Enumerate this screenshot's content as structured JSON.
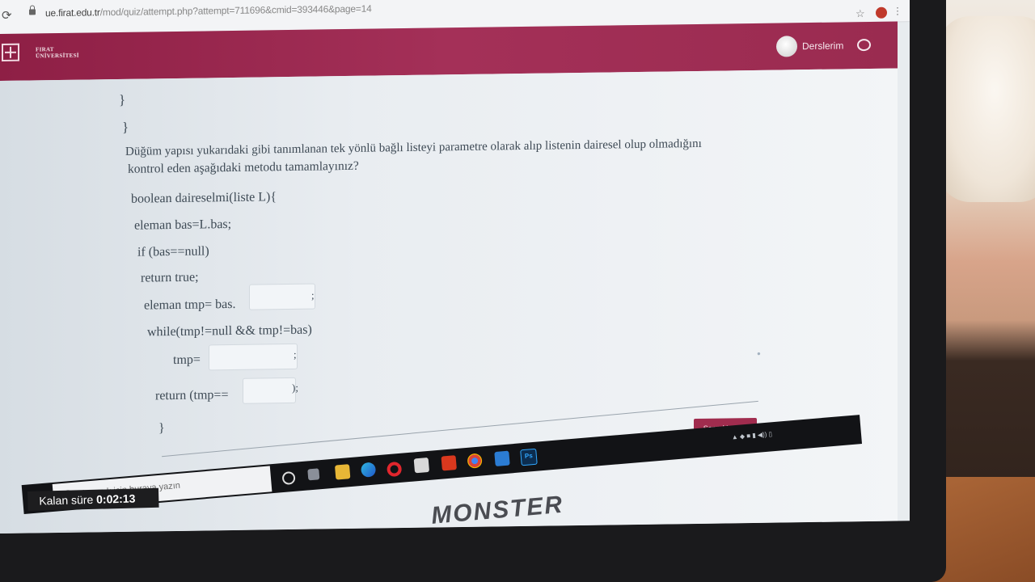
{
  "browser": {
    "url_host": "ue.firat.edu.tr",
    "url_path": "/mod/quiz/attempt.php?attempt=711696&cmid=393446&page=14",
    "icons": [
      "reload-icon",
      "lock-icon",
      "star-icon",
      "profile-icon",
      "menu-icon"
    ]
  },
  "site": {
    "logo_line1": "FIRAT",
    "logo_line2": "ÜNİVERSİTESİ",
    "nav_courses": "Derslerim",
    "brand_color": "#9a2b50"
  },
  "question": {
    "brace_inner": "}",
    "brace_outer": "}",
    "prompt_line1": "Düğüm yapısı yukarıdaki gibi tanımlanan tek yönlü bağlı listeyi parametre olarak alıp listenin dairesel olup olmadığını",
    "prompt_line2": "kontrol eden aşağıdaki metodu tamamlayınız?",
    "code": {
      "line1": "boolean daireselmi(liste L){",
      "line2": "eleman bas=L.bas;",
      "line3": "if (bas==null)",
      "line4": "return true;",
      "line5": "eleman tmp= bas.",
      "line5_after": ";",
      "line6": "while(tmp!=null && tmp!=bas)",
      "line7": "tmp=",
      "line7_after": ";",
      "line8": "return (tmp==",
      "line8_after": ");",
      "line9": "}"
    },
    "blank1_value": "",
    "blank2_value": "",
    "blank3_value": ""
  },
  "navigation": {
    "next_page": "Sonraki sayfa"
  },
  "timer": {
    "label": "Kalan süre",
    "value": "0:02:13"
  },
  "taskbar": {
    "search_placeholder": "Aramak için buraya yazın",
    "ps_label": "Ps"
  },
  "laptop": {
    "brand": "MONSTER"
  }
}
